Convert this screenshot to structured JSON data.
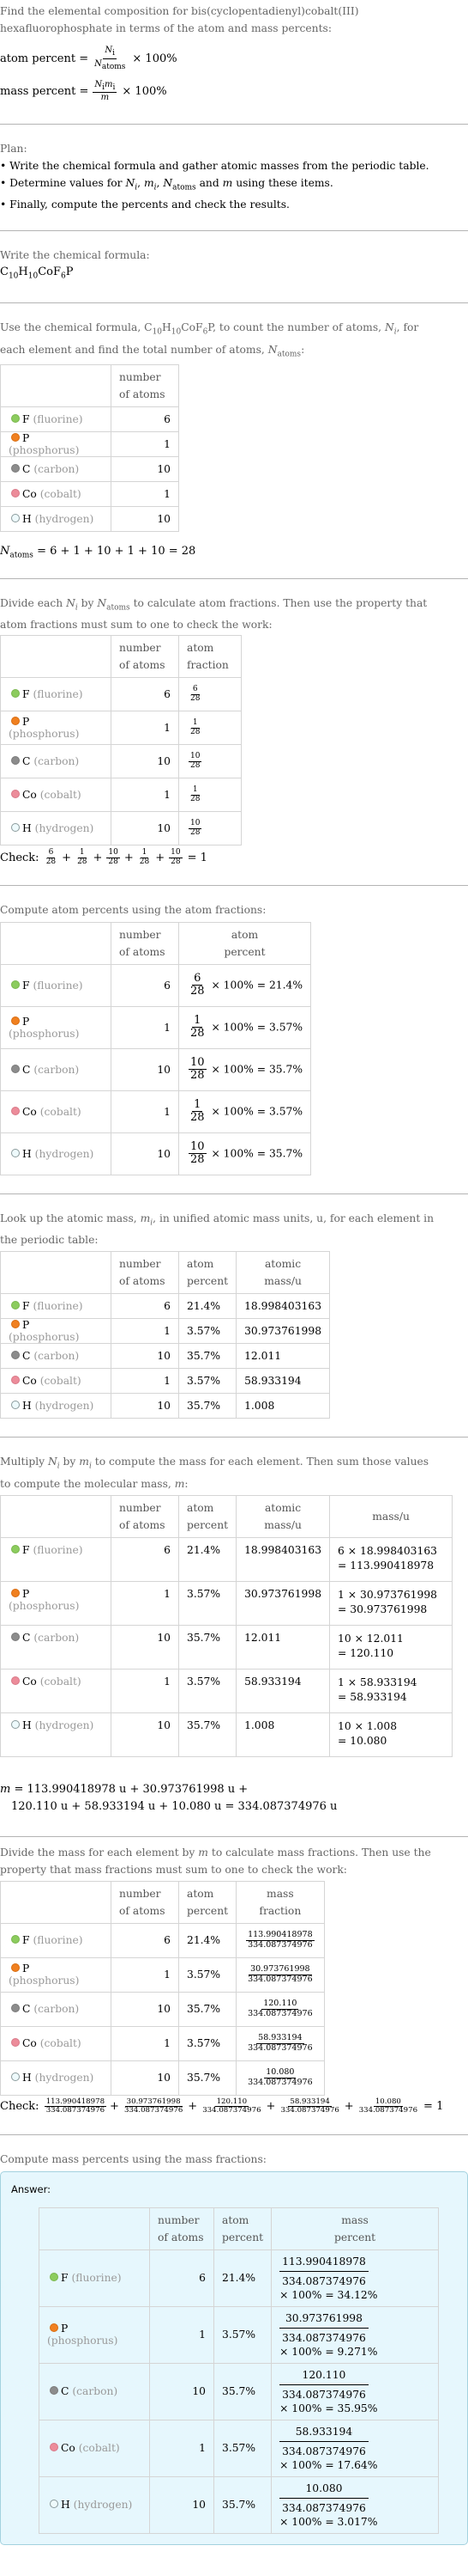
{
  "intro": {
    "line1": "Find the elemental composition for bis(cyclopentadienyl)cobalt(III)",
    "line2": "hexafluorophosphate in terms of the atom and mass percents:",
    "atom_percent_label": "atom percent =",
    "atom_percent_num": "N",
    "atom_percent_num_sub": "i",
    "atom_percent_den": "N",
    "atom_percent_den_sub": "atoms",
    "times_100": "× 100%",
    "mass_percent_label": "mass percent =",
    "mass_percent_num": "N",
    "mass_percent_num_sub": "i",
    "mass_percent_num2": "m",
    "mass_percent_num2_sub": "i",
    "mass_percent_den": "m"
  },
  "plan": {
    "title": "Plan:",
    "items": [
      "• Write the chemical formula and gather atomic masses from the periodic table.",
      "• Determine values for N_i, m_i, N_atoms and m using these items.",
      "• Finally, compute the percents and check the results."
    ]
  },
  "formula_step": {
    "label": "Write the chemical formula:",
    "formula": [
      {
        "t": "C"
      },
      {
        "s": "10"
      },
      {
        "t": "H"
      },
      {
        "s": "10"
      },
      {
        "t": "CoF"
      },
      {
        "s": "6"
      },
      {
        "t": "P"
      }
    ]
  },
  "count_step": {
    "text_a": "Use the chemical formula, ",
    "text_b": ", to count the number of atoms, ",
    "text_c": ", for",
    "text_d": "each element and find the total number of atoms, ",
    "text_e": ":",
    "n_atoms_eq": "= 6 + 1 + 10 + 1 + 10 = 28"
  },
  "headers": {
    "number_of_atoms": [
      "number",
      "of atoms"
    ],
    "atom_fraction": [
      "atom",
      "fraction"
    ],
    "atom_percent": [
      "atom",
      "percent"
    ],
    "atomic_mass": [
      "atomic",
      "mass/u"
    ],
    "mass_u": "mass/u",
    "mass_fraction": [
      "mass",
      "fraction"
    ],
    "mass_percent": [
      "mass",
      "percent"
    ]
  },
  "elements": [
    {
      "symbol": "F",
      "name": "(fluorine)",
      "color": "#8ccc5e",
      "border": "#7ab64e",
      "count": "6",
      "fraction_num": "6",
      "fraction_den": "28",
      "atom_pct_calc": "× 100% = 21.4%",
      "atom_pct": "21.4%",
      "atomic_mass": "18.998403163",
      "mass_calc1": "6 × 18.998403163",
      "mass_calc2": "= 113.990418978",
      "mass": "113.990418978",
      "mass_pct": "× 100% = 34.12%"
    },
    {
      "symbol": "P",
      "name": "(phosphorus)",
      "color": "#f08020",
      "border": "#d86c10",
      "count": "1",
      "fraction_num": "1",
      "fraction_den": "28",
      "atom_pct_calc": "× 100% = 3.57%",
      "atom_pct": "3.57%",
      "atomic_mass": "30.973761998",
      "mass_calc1": "1 × 30.973761998",
      "mass_calc2": "= 30.973761998",
      "mass": "30.973761998",
      "mass_pct": "× 100% = 9.271%"
    },
    {
      "symbol": "C",
      "name": "(carbon)",
      "color": "#8c8c8c",
      "border": "#7a7a7a",
      "count": "10",
      "fraction_num": "10",
      "fraction_den": "28",
      "atom_pct_calc": "× 100% = 35.7%",
      "atom_pct": "35.7%",
      "atomic_mass": "12.011",
      "mass_calc1": "10 × 12.011",
      "mass_calc2": "= 120.110",
      "mass": "120.110",
      "mass_pct": "× 100% = 35.95%"
    },
    {
      "symbol": "Co",
      "name": "(cobalt)",
      "color": "#ec8c9a",
      "border": "#d87888",
      "count": "1",
      "fraction_num": "1",
      "fraction_den": "28",
      "atom_pct_calc": "× 100% = 3.57%",
      "atom_pct": "3.57%",
      "atomic_mass": "58.933194",
      "mass_calc1": "1 × 58.933194",
      "mass_calc2": "= 58.933194",
      "mass": "58.933194",
      "mass_pct": "× 100% = 17.64%"
    },
    {
      "symbol": "H",
      "name": "(hydrogen)",
      "color": "#eefafc",
      "border": "#8a9a9c",
      "count": "10",
      "fraction_num": "10",
      "fraction_den": "28",
      "atom_pct_calc": "× 100% = 35.7%",
      "atom_pct": "35.7%",
      "atomic_mass": "1.008",
      "mass_calc1": "10 × 1.008",
      "mass_calc2": "= 10.080",
      "mass": "10.080",
      "mass_pct": "× 100% = 3.017%"
    }
  ],
  "fraction_step": {
    "text_a": "Divide each ",
    "text_b": " by ",
    "text_c": " to calculate atom fractions. Then use the property that",
    "text_d": "atom fractions must sum to one to check the work:",
    "check_label": "Check:",
    "check_result": "= 1"
  },
  "atom_percent_step": {
    "label": "Compute atom percents using the atom fractions:"
  },
  "mass_lookup_step": {
    "text_a": "Look up the atomic mass, ",
    "text_b": ", in unified atomic mass units, u, for each element in",
    "text_c": "the periodic table:"
  },
  "molecular_mass_step": {
    "text_a": "Multiply ",
    "text_b": " by ",
    "text_c": " to compute the mass for each element. Then sum those values",
    "text_d": "to compute the molecular mass, ",
    "text_e": ":",
    "eq_line1": "= 113.990418978 u + 30.973761998 u +",
    "eq_line2": "120.110 u + 58.933194 u + 10.080 u = 334.087374976 u",
    "total_mass": "334.087374976"
  },
  "mass_fraction_step": {
    "text_a": "Divide the mass for each element by ",
    "text_b": " to calculate mass fractions. Then use the",
    "text_c": "property that mass fractions must sum to one to check the work:",
    "check_label": "Check:",
    "check_result": "= 1"
  },
  "mass_percent_step": {
    "label": "Compute mass percents using the mass fractions:",
    "answer_label": "Answer:"
  },
  "colors": {
    "answer_bg": "#e6f7fd",
    "answer_border": "#a3d2df",
    "rule": "#b4b4b4"
  }
}
